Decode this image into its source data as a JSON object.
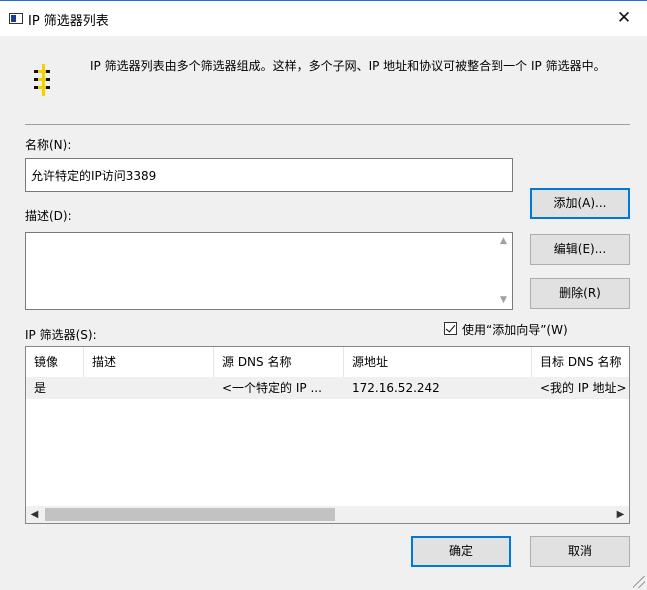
{
  "window": {
    "title": "IP 筛选器列表",
    "close_glyph": "✕"
  },
  "header": {
    "icon": "filter-list-icon",
    "description": "IP 筛选器列表由多个筛选器组成。这样，多个子网、IP 地址和协议可被整合到一个 IP 筛选器中。"
  },
  "form": {
    "name_label": "名称(N):",
    "name_value": "允许特定的IP访问3389",
    "desc_label": "描述(D):",
    "desc_value": "",
    "filters_label": "IP 筛选器(S):",
    "wizard_checkbox_label": "使用“添加向导”(W)",
    "wizard_checked": true
  },
  "buttons": {
    "add": "添加(A)...",
    "edit": "编辑(E)...",
    "delete": "删除(R)",
    "ok": "确定",
    "cancel": "取消"
  },
  "table": {
    "columns": [
      "镜像",
      "描述",
      "源 DNS 名称",
      "源地址",
      "目标 DNS 名称"
    ],
    "rows": [
      [
        "是",
        "",
        "<一个特定的 IP ...",
        "172.16.52.242",
        "<我的 IP 地址>"
      ]
    ]
  },
  "colors": {
    "accent": "#0078d7",
    "window_bg": "#f0f0f0"
  }
}
